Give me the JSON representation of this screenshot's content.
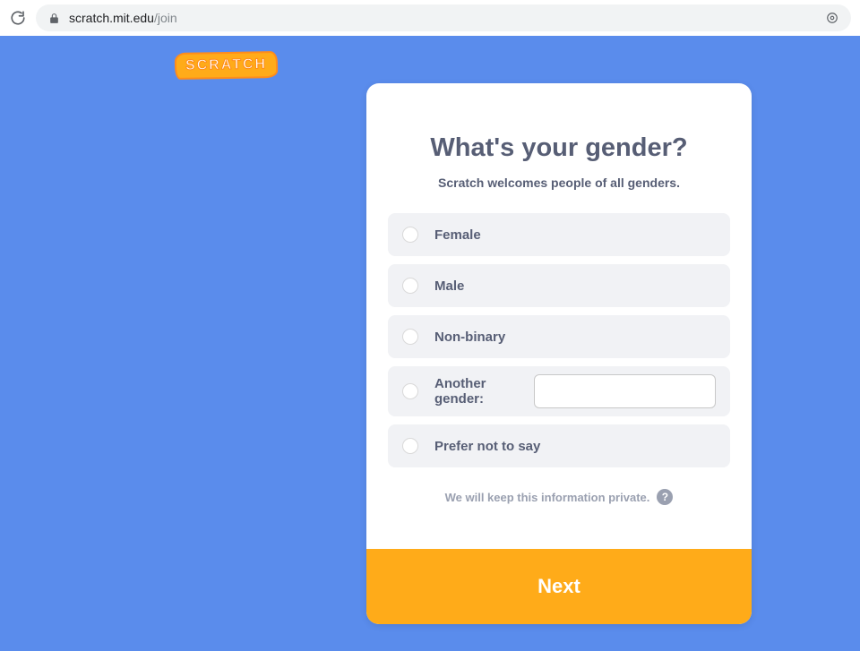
{
  "browser": {
    "url_domain": "scratch.mit.edu",
    "url_path": "/join"
  },
  "logo": {
    "text": "SCRATCH"
  },
  "form": {
    "title": "What's your gender?",
    "subtitle": "Scratch welcomes people of all genders.",
    "options": {
      "female": "Female",
      "male": "Male",
      "nonbinary": "Non-binary",
      "another": "Another gender:",
      "prefer": "Prefer not to say"
    },
    "custom_value": "",
    "privacy_text": "We will keep this information private.",
    "next_label": "Next"
  }
}
